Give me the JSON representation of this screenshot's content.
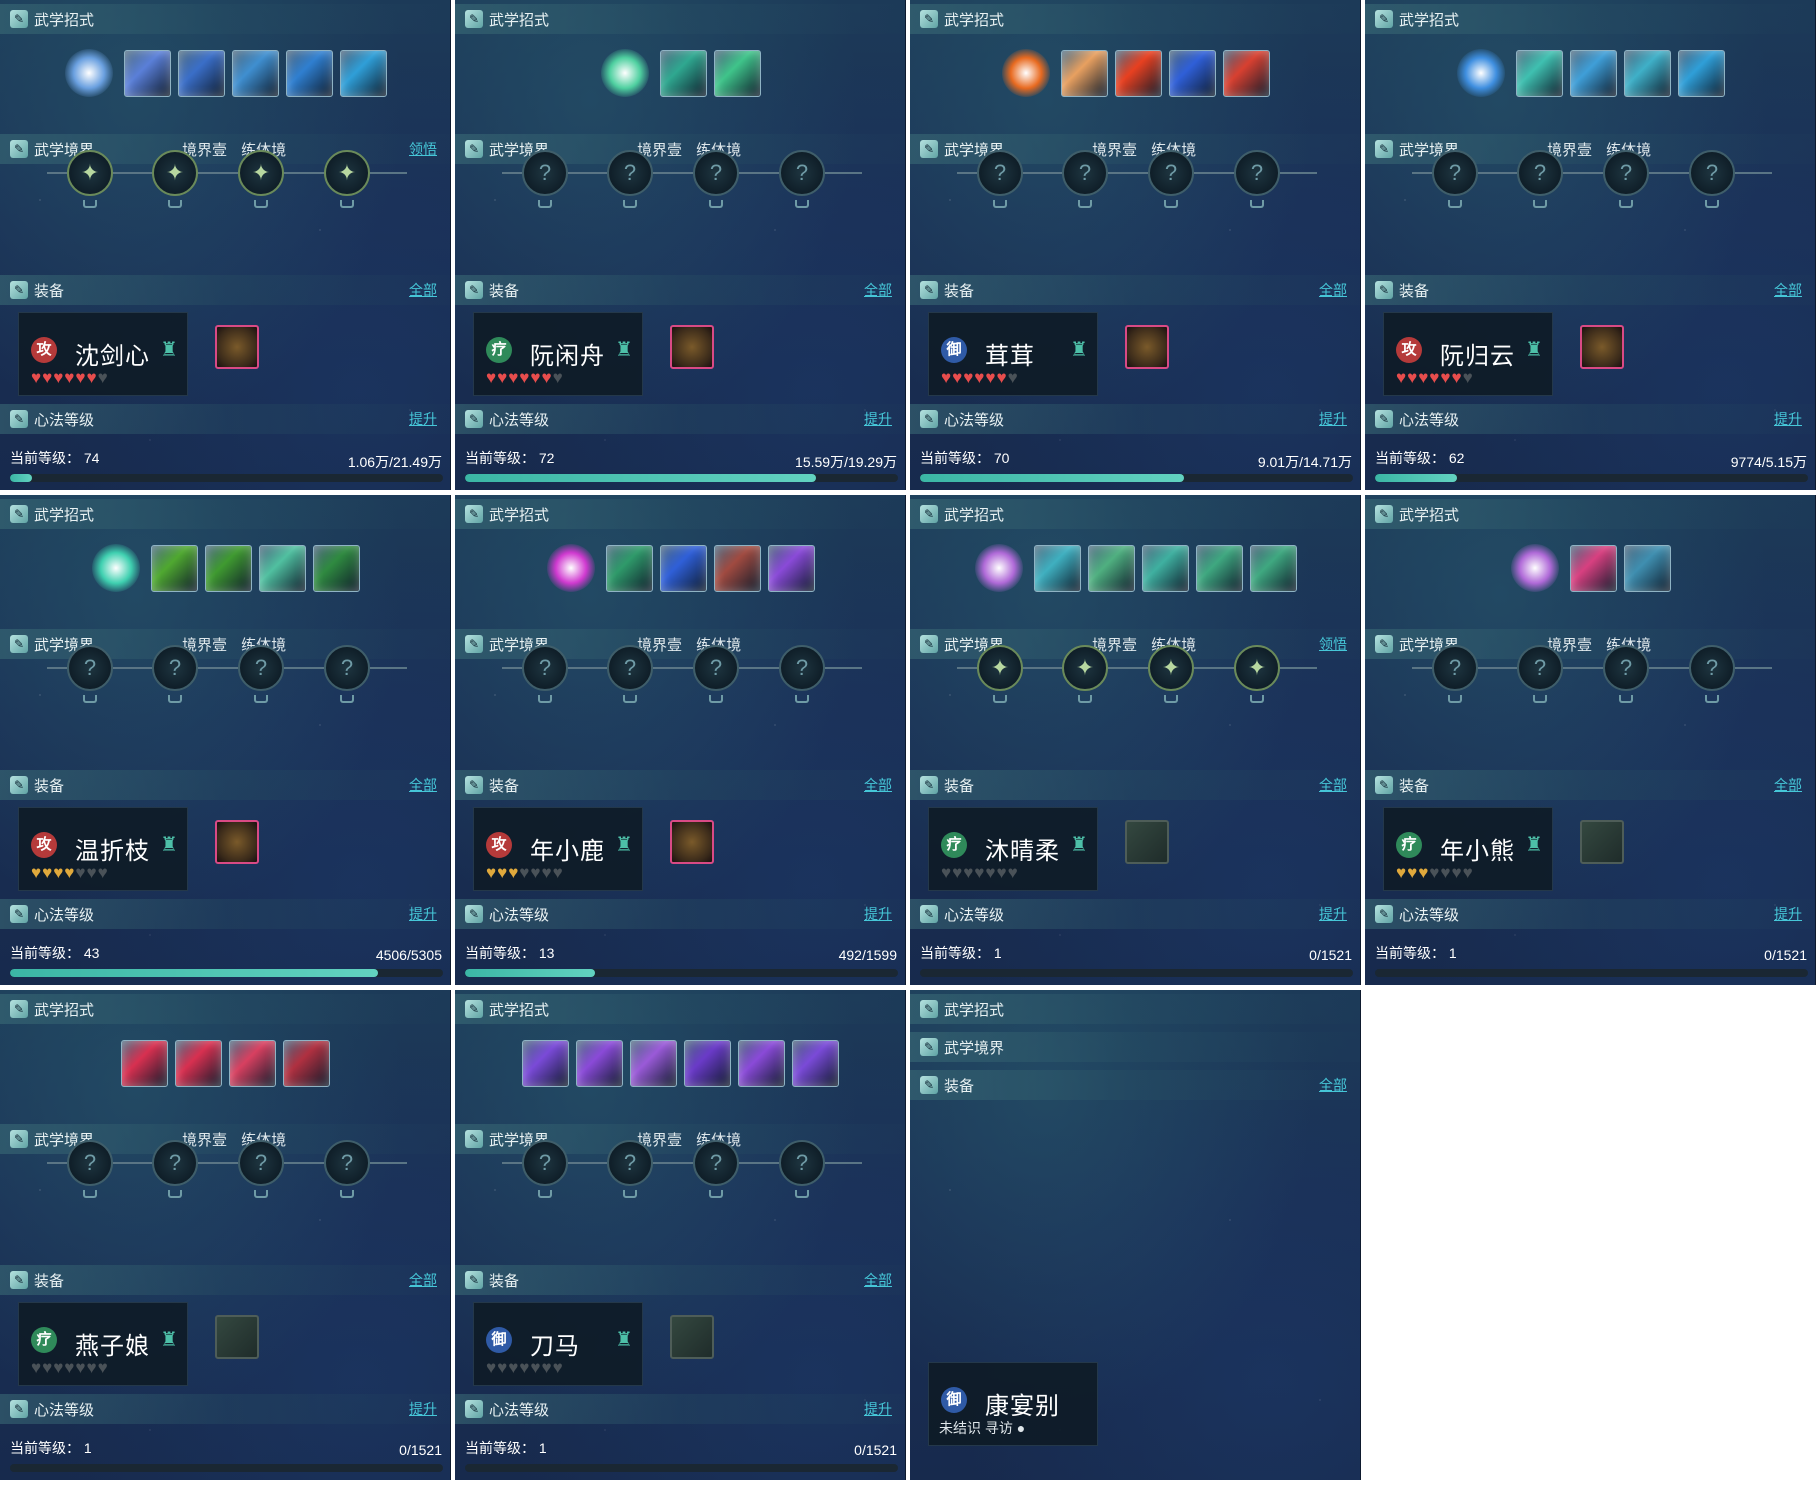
{
  "labels": {
    "skills": "武学招式",
    "realm": "武学境界",
    "realm_tag1": "境界壹",
    "realm_tag2": "练体境",
    "realm_action": "领悟",
    "equip": "装备",
    "equip_all": "全部",
    "heart": "心法等级",
    "heart_action": "提升",
    "level_prefix": "当前等级：",
    "unknown": "未结识",
    "seek": "寻访"
  },
  "icons": {
    "section": "sword-scroll-icon",
    "node_unknown": "question-swirl-icon",
    "char_emblem": "teapot-icon",
    "location": "location-pin-icon"
  },
  "colors": {
    "accent": "#46c7d8",
    "progress": "#3bb6a5",
    "heart_red": "#e84d4d",
    "heart_gold": "#e0a93c",
    "heart_empty": "#4a5258",
    "gear_border": "#d94a85",
    "role_attack": "#b53a3a",
    "role_heal": "#2f8a5a",
    "role_defense": "#2f5aa6"
  },
  "characters": [
    {
      "name": "沈剑心",
      "role": "攻",
      "role_type": "attack",
      "hearts_filled": 6,
      "hearts_total": 7,
      "heart_color": "red",
      "gear": true,
      "level": "74",
      "exp": "1.06万/21.49万",
      "progress": 0.05,
      "realm_action": true,
      "skill_count": 5,
      "skill_colors": [
        "#5a7fd8",
        "#3a6ec8",
        "#3f8fd0",
        "#2f7fd0",
        "#2f9fd8"
      ],
      "orb_color": "#6aa0e0",
      "nodes_unlocked": true
    },
    {
      "name": "阮闲舟",
      "role": "疗",
      "role_type": "heal",
      "hearts_filled": 6,
      "hearts_total": 7,
      "heart_color": "red",
      "gear": true,
      "level": "72",
      "exp": "15.59万/19.29万",
      "progress": 0.81,
      "realm_action": false,
      "skill_count": 2,
      "skill_colors": [
        "#2fa890",
        "#3fc48a"
      ],
      "orb_color": "#4fd0a0",
      "nodes_unlocked": false
    },
    {
      "name": "茸茸",
      "role": "御",
      "role_type": "defense",
      "hearts_filled": 6,
      "hearts_total": 7,
      "heart_color": "red",
      "gear": true,
      "level": "70",
      "exp": "9.01万/14.71万",
      "progress": 0.61,
      "realm_action": false,
      "skill_count": 4,
      "skill_colors": [
        "#e8a060",
        "#e84020",
        "#2f5fd8",
        "#d84030"
      ],
      "orb_color": "#e86a20",
      "nodes_unlocked": false
    },
    {
      "name": "阮归云",
      "role": "攻",
      "role_type": "attack",
      "hearts_filled": 6,
      "hearts_total": 7,
      "heart_color": "red",
      "gear": true,
      "level": "62",
      "exp": "9774/5.15万",
      "progress": 0.19,
      "realm_action": false,
      "skill_count": 4,
      "skill_colors": [
        "#3fc0b0",
        "#3f9fd8",
        "#3fb0c8",
        "#2f9fd8"
      ],
      "orb_color": "#3f8fe0",
      "nodes_unlocked": false
    },
    {
      "name": "温折枝",
      "role": "攻",
      "role_type": "attack",
      "hearts_filled": 4,
      "hearts_total": 7,
      "heart_color": "gold",
      "gear": true,
      "level": "43",
      "exp": "4506/5305",
      "progress": 0.85,
      "realm_action": false,
      "skill_count": 4,
      "skill_colors": [
        "#4fa830",
        "#3f9a30",
        "#50c0a0",
        "#2f8a40"
      ],
      "orb_color": "#3fd0b0",
      "nodes_unlocked": false
    },
    {
      "name": "年小鹿",
      "role": "攻",
      "role_type": "attack",
      "hearts_filled": 3,
      "hearts_total": 7,
      "heart_color": "gold",
      "gear": true,
      "level": "13",
      "exp": "492/1599",
      "progress": 0.3,
      "realm_action": false,
      "skill_count": 4,
      "skill_colors": [
        "#2f9a6a",
        "#2f5fd8",
        "#a04a40",
        "#8a4ad8"
      ],
      "orb_color": "#d03ad0",
      "nodes_unlocked": false
    },
    {
      "name": "沐晴柔",
      "role": "疗",
      "role_type": "heal",
      "hearts_filled": 0,
      "hearts_total": 7,
      "heart_color": "red",
      "gear": false,
      "level": "1",
      "exp": "0/1521",
      "progress": 0,
      "realm_action": true,
      "skill_count": 5,
      "skill_colors": [
        "#3fb0c0",
        "#4fb080",
        "#3fb0a0",
        "#3fa880",
        "#3fa880"
      ],
      "orb_color": "#b06ad8",
      "nodes_unlocked": true
    },
    {
      "name": "年小熊",
      "role": "疗",
      "role_type": "heal",
      "hearts_filled": 3,
      "hearts_total": 7,
      "heart_color": "gold",
      "gear": false,
      "level": "1",
      "exp": "0/1521",
      "progress": 0,
      "realm_action": false,
      "skill_count": 2,
      "skill_colors": [
        "#d84080",
        "#3f8fb0"
      ],
      "orb_color": "#b06ad8",
      "nodes_unlocked": false
    },
    {
      "name": "燕子娘",
      "role": "疗",
      "role_type": "heal",
      "hearts_filled": 0,
      "hearts_total": 7,
      "heart_color": "red",
      "gear": false,
      "level": "1",
      "exp": "0/1521",
      "progress": 0,
      "realm_action": false,
      "skill_count": 4,
      "skill_colors": [
        "#d83050",
        "#d83050",
        "#d84060",
        "#b03040"
      ],
      "orb_color": null,
      "nodes_unlocked": false
    },
    {
      "name": "刀马",
      "role": "御",
      "role_type": "defense",
      "hearts_filled": 0,
      "hearts_total": 7,
      "heart_color": "red",
      "gear": false,
      "level": "1",
      "exp": "0/1521",
      "progress": 0,
      "realm_action": false,
      "skill_count": 6,
      "skill_colors": [
        "#7a4ad8",
        "#8a4ad8",
        "#9a5ad8",
        "#6a3ac8",
        "#8a4ad8",
        "#7a4ad8"
      ],
      "orb_color": null,
      "nodes_unlocked": false
    },
    {
      "name": "康宴别",
      "role": "御",
      "role_type": "defense",
      "unknown": true
    }
  ]
}
